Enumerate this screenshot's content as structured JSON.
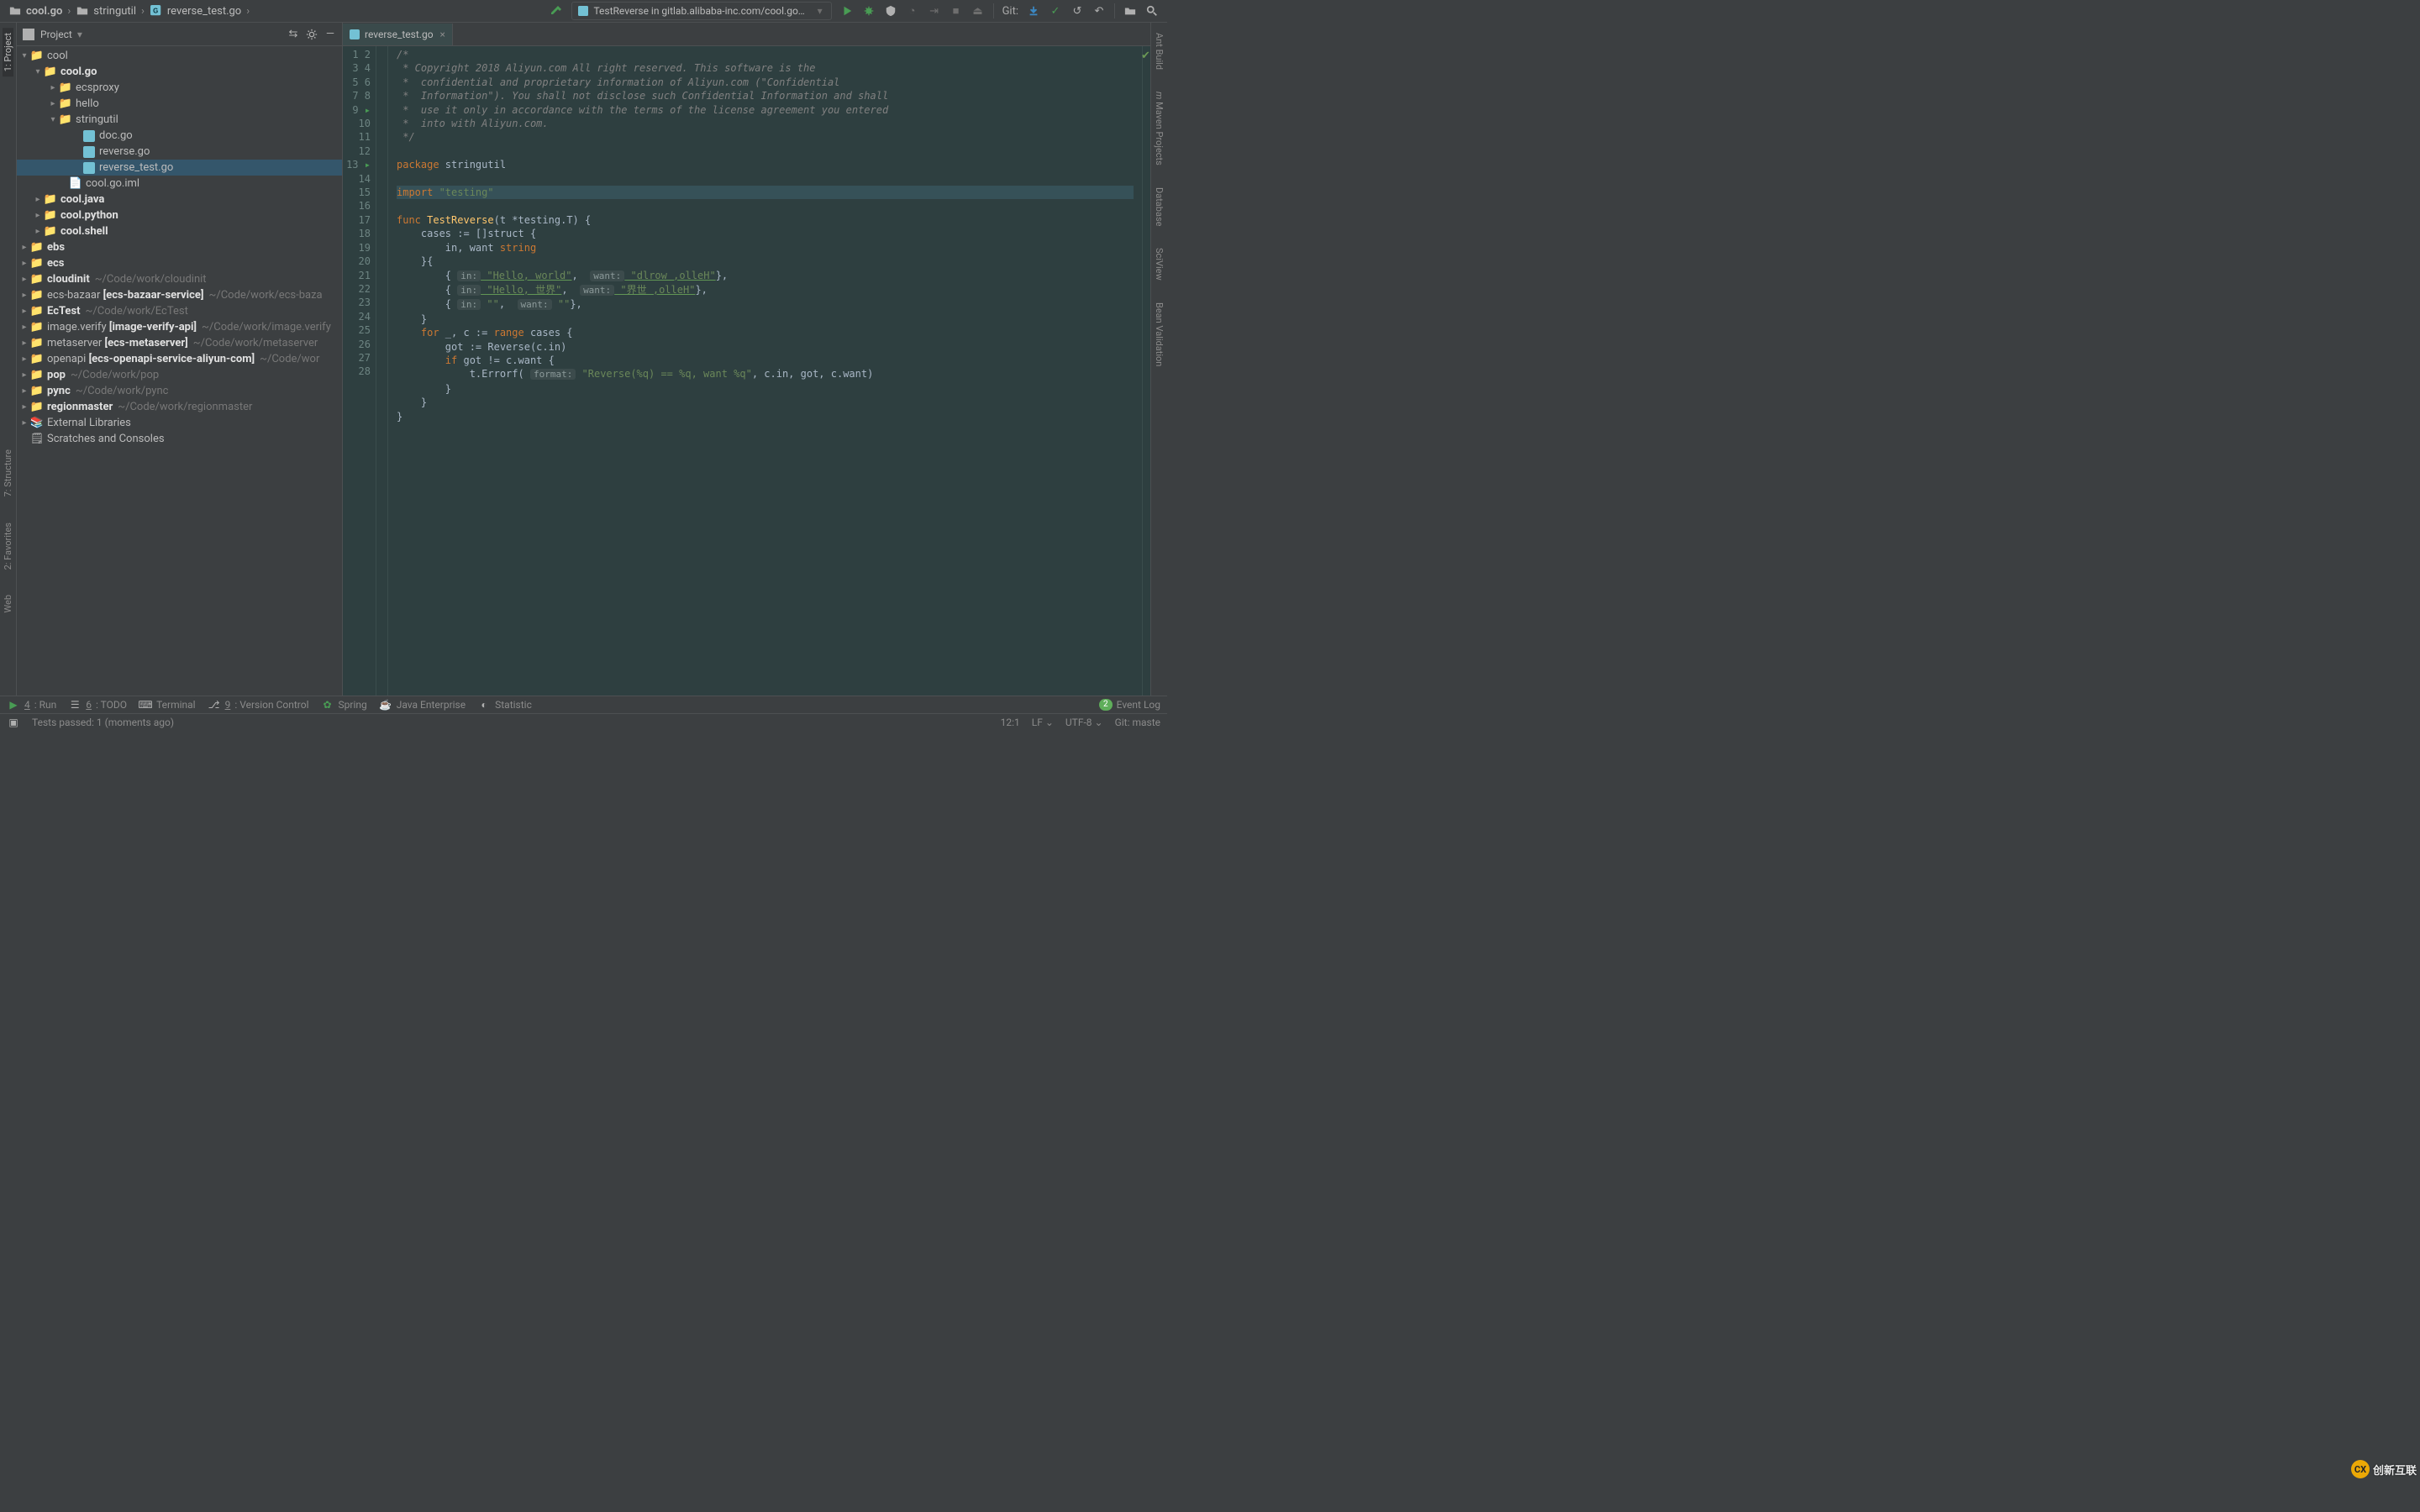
{
  "breadcrumbs": [
    "cool.go",
    "stringutil",
    "reverse_test.go"
  ],
  "run_config": "TestReverse in gitlab.alibaba-inc.com/cool.go/stringutil",
  "git_label": "Git:",
  "project_panel": {
    "title": "Project"
  },
  "tree": {
    "root": "cool",
    "cool_go": "cool.go",
    "ecsproxy": "ecsproxy",
    "hello": "hello",
    "stringutil": "stringutil",
    "doc_go": "doc.go",
    "reverse_go": "reverse.go",
    "reverse_test_go": "reverse_test.go",
    "cool_iml": "cool.go.iml",
    "cool_java": "cool.java",
    "cool_python": "cool.python",
    "cool_shell": "cool.shell",
    "ebs": "ebs",
    "ecs": "ecs",
    "cloudinit": "cloudinit",
    "cloudinit_hint": "~/Code/work/cloudinit",
    "ecs_bazaar": "ecs-bazaar",
    "ecs_bazaar_b": "[ecs-bazaar-service]",
    "ecs_bazaar_hint": "~/Code/work/ecs-baza",
    "ectest": "EcTest",
    "ectest_hint": "~/Code/work/EcTest",
    "image_verify": "image.verify",
    "image_verify_b": "[image-verify-api]",
    "image_verify_hint": "~/Code/work/image.verify",
    "metaserver": "metaserver",
    "metaserver_b": "[ecs-metaserver]",
    "metaserver_hint": "~/Code/work/metaserver",
    "openapi": "openapi",
    "openapi_b": "[ecs-openapi-service-aliyun-com]",
    "openapi_hint": "~/Code/wor",
    "pop": "pop",
    "pop_hint": "~/Code/work/pop",
    "pync": "pync",
    "pync_hint": "~/Code/work/pync",
    "regionmaster": "regionmaster",
    "regionmaster_hint": "~/Code/work/regionmaster",
    "ext_lib": "External Libraries",
    "scratches": "Scratches and Consoles"
  },
  "tab_name": "reverse_test.go",
  "code": {
    "l1": "/*",
    "l2": " * Copyright 2018 Aliyun.com All right reserved. This software is the",
    "l3": " *  confidential and proprietary information of Aliyun.com (\"Confidential",
    "l4": " *  Information\"). You shall not disclose such Confidential Information and shall",
    "l5": " *  use it only in accordance with the terms of the license agreement you entered",
    "l6": " *  into with Aliyun.com.",
    "l7": " */",
    "l9a": "package",
    "l9b": " stringutil",
    "l11a": "import",
    "l11b": " \"testing\"",
    "l13a": "func ",
    "l13b": "TestReverse",
    "l13c": "(t *testing.",
    "l13d": "T",
    "l13e": ") {",
    "l14": "    cases := []struct {",
    "l15a": "        in, want ",
    "l15b": "string",
    "l16": "    }{",
    "l17a": "        { ",
    "l17in": "in:",
    "l17b": " \"Hello, world\"",
    "l17c": ",  ",
    "l17want": "want:",
    "l17d": " \"dlrow ,olleH\"",
    "l17e": "},",
    "l18a": "        { ",
    "l18in": "in:",
    "l18b": " \"Hello, 世界\"",
    "l18c": ",  ",
    "l18want": "want:",
    "l18d": " \"界世 ,olleH\"",
    "l18e": "},",
    "l19a": "        { ",
    "l19in": "in:",
    "l19b": " \"\"",
    "l19c": ",  ",
    "l19want": "want:",
    "l19d": " \"\"",
    "l19e": "},",
    "l20": "    }",
    "l21a": "    for ",
    "l21b": "_, c := ",
    "l21c": "range",
    "l21d": " cases {",
    "l22": "        got := Reverse(c.in)",
    "l23a": "        if ",
    "l23b": "got != c.want {",
    "l24a": "            t.Errorf( ",
    "l24fmt": "format:",
    "l24b": " \"Reverse(%q) == %q, want %q\"",
    "l24c": ", c.in, got, c.want)",
    "l25": "        }",
    "l26": "    }",
    "l27": "}"
  },
  "left_tabs": {
    "project": "1: Project",
    "structure": "7: Structure",
    "favorites": "2: Favorites",
    "web": "Web"
  },
  "right_tabs": {
    "ant": "Ant Build",
    "maven": "Maven Projects",
    "database": "Database",
    "sciview": "SciView",
    "bean": "Bean Validation"
  },
  "bottom": {
    "run": "4: Run",
    "todo": "6: TODO",
    "terminal": "Terminal",
    "vcs": "9: Version Control",
    "spring": "Spring",
    "javaee": "Java Enterprise",
    "statistic": "Statistic",
    "event_log": "Event Log",
    "badge": "2"
  },
  "status": {
    "msg": "Tests passed: 1 (moments ago)",
    "pos": "12:1",
    "lf": "LF",
    "enc": "UTF-8",
    "git": "Git: maste"
  },
  "watermark": "创新互联",
  "colors": {
    "bg": "#2b2b2b",
    "accent": "#499c54"
  }
}
